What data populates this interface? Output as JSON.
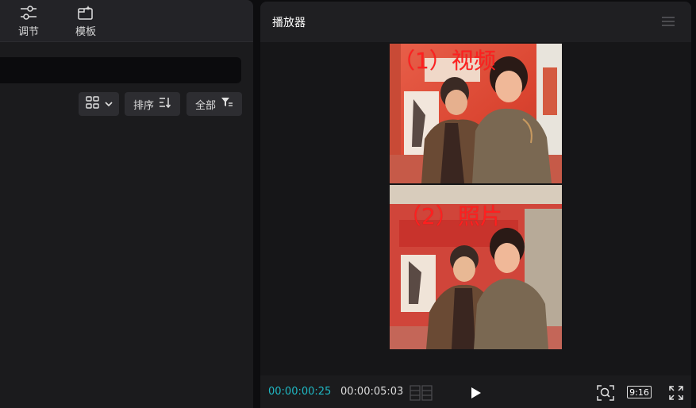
{
  "left_toolbar": {
    "items": [
      {
        "label": "调节",
        "icon": "sliders-icon"
      },
      {
        "label": "模板",
        "icon": "template-icon"
      }
    ]
  },
  "media_controls": {
    "view_toggle_icon": "grid-view-icon",
    "sort_label": "排序",
    "filter_label": "全部"
  },
  "player": {
    "title": "播放器",
    "current_time": "00:00:00:25",
    "total_time": "00:00:05:03",
    "aspect_ratio": "9:16",
    "overlay_top": "（1）视频",
    "overlay_bottom": "（2）照片",
    "accent_color": "#1fb8c4",
    "overlay_color": "#ff1f1f"
  }
}
